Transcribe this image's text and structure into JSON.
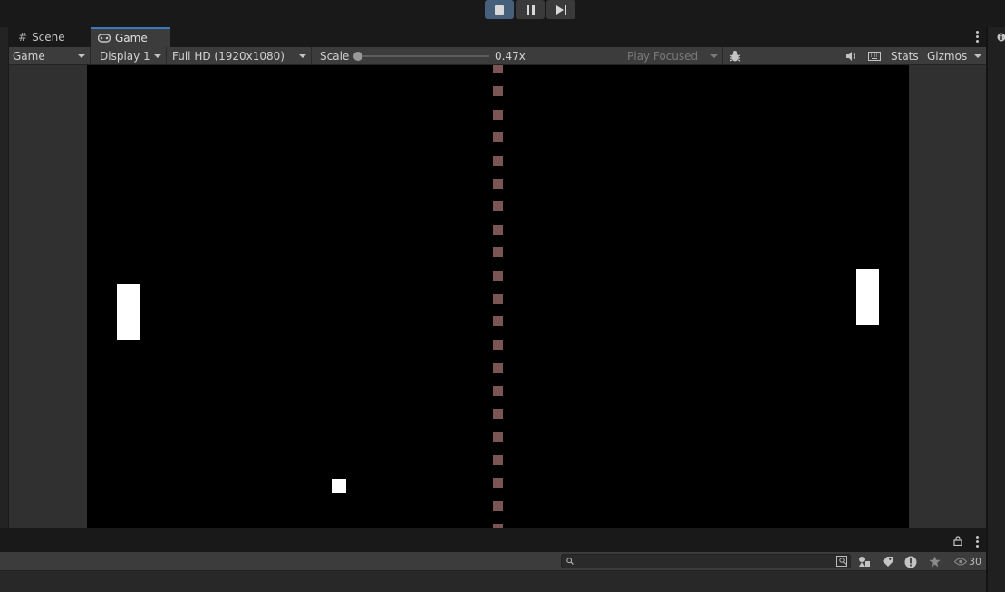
{
  "tabs": [
    {
      "label": "Scene",
      "icon": "hash-icon"
    },
    {
      "label": "Game",
      "icon": "gamepad-icon"
    }
  ],
  "toolbar": {
    "mode": "Game",
    "display": "Display 1",
    "resolution": "Full HD (1920x1080)",
    "scale_label": "Scale",
    "scale_value": "0.47x",
    "play_focused": "Play Focused",
    "stats": "Stats",
    "gizmos": "Gizmos"
  },
  "bottom": {
    "visible_count": "30"
  },
  "colors": {
    "accent": "#3a79bb",
    "play_active": "#46607c",
    "net_dash": "#7b5554",
    "panel": "#3c3c3c",
    "background": "#191919"
  }
}
